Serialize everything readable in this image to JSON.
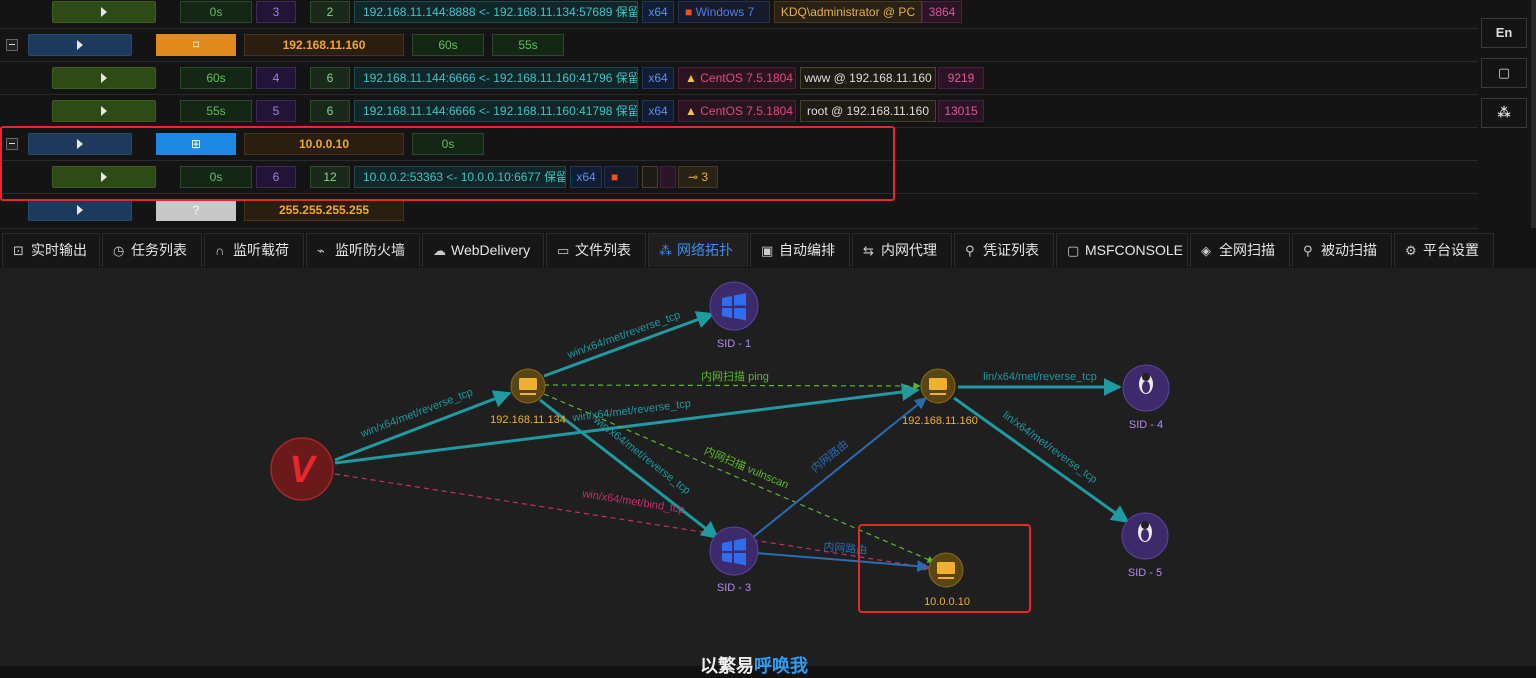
{
  "sessions": {
    "row1": {
      "time": "0s",
      "sid": "3",
      "count": "2",
      "conn": "192.168.11.144:8888 <- 192.168.11.134:57689 保留",
      "arch": "x64",
      "os": "Windows 7",
      "user": "KDQ\\administrator @ PC",
      "pid": "3864"
    },
    "host1": {
      "ip": "192.168.11.160",
      "t1": "60s",
      "t2": "55s"
    },
    "row2": {
      "time": "60s",
      "sid": "4",
      "count": "6",
      "conn": "192.168.11.144:6666 <- 192.168.11.160:41796 保留",
      "arch": "x64",
      "os": "CentOS 7.5.1804",
      "user": "www @ 192.168.11.160",
      "pid": "9219"
    },
    "row3": {
      "time": "55s",
      "sid": "5",
      "count": "6",
      "conn": "192.168.11.144:6666 <- 192.168.11.160:41798 保留",
      "arch": "x64",
      "os": "CentOS 7.5.1804",
      "user": "root @ 192.168.11.160",
      "pid": "13015"
    },
    "host2": {
      "ip": "10.0.0.10",
      "t1": "0s"
    },
    "row4": {
      "time": "0s",
      "sid": "6",
      "count": "12",
      "conn": "10.0.0.2:53363 <- 10.0.0.10:6677 保留",
      "arch": "x64",
      "keys": "3"
    },
    "host3": {
      "ip": "255.255.255.255",
      "mark": "?"
    }
  },
  "side": {
    "lang": "En"
  },
  "tabs": [
    "实时输出",
    "任务列表",
    "监听载荷",
    "监听防火墙",
    "WebDelivery",
    "文件列表",
    "网络拓扑",
    "自动编排",
    "内网代理",
    "凭证列表",
    "MSFCONSOLE",
    "全网扫描",
    "被动扫描",
    "平台设置"
  ],
  "graph": {
    "nodes": {
      "sid1": "SID - 1",
      "host134": "192.168.11.134",
      "host160": "192.168.11.160",
      "sid4": "SID - 4",
      "sid3": "SID - 3",
      "host10": "10.0.0.10",
      "sid5": "SID - 5",
      "viper": "V"
    },
    "edges": {
      "e1": "win/x64/met/reverse_tcp",
      "e2": "win/x64/met/reverse_tcp",
      "e3": "lin/x64/met/reverse_tcp",
      "e4": "lin/x64/met/reverse_tcp",
      "e5": "win/x64/met/reverse_tcp",
      "e6": "lin/x64/met/reverse_tcp",
      "e7": "win/x64/met/bind_tcp",
      "scan_ping": "内网扫描 ping",
      "scan_vuln": "内网扫描 vulnscan",
      "route1": "内网路由",
      "route2": "内网路由"
    }
  },
  "footer": {
    "a": "以繁易",
    "b": "呼唤我"
  },
  "colors": {
    "accent": "#3e8ef7",
    "highlight": "#e8262b",
    "teal": "#1e9aa0",
    "green_dash": "#5db82e",
    "pink_dash": "#c2306e",
    "route_blue": "#2a6cb0"
  }
}
